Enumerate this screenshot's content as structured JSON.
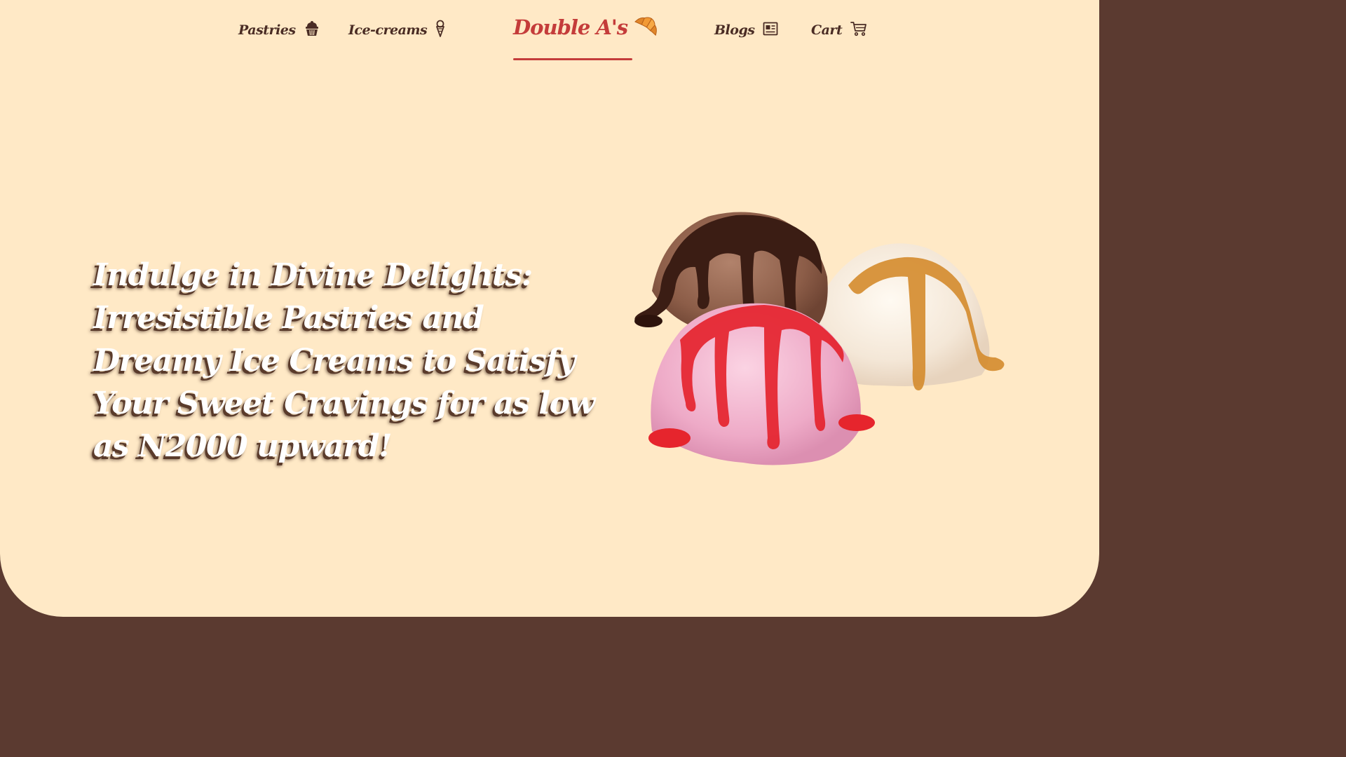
{
  "nav": {
    "pastries": {
      "label": "Pastries",
      "icon": "cupcake-icon"
    },
    "icecreams": {
      "label": "Ice-creams",
      "icon": "ice-cream-cone-icon"
    },
    "blogs": {
      "label": "Blogs",
      "icon": "newspaper-icon"
    },
    "cart": {
      "label": "Cart",
      "icon": "cart-icon"
    }
  },
  "logo": {
    "text": "Double A's",
    "icon": "croissant-icon",
    "color": "#c43c3a"
  },
  "hero": {
    "headline": "Indulge in Divine Delights: Irresistible Pastries and Dreamy Ice Creams to Satisfy Your Sweet Cravings for as low as N2000 upward!",
    "image": "three-ice-cream-scoops-illustration"
  },
  "colors": {
    "background": "#ffe9c6",
    "footer": "#5b3a30",
    "nav_text": "#4a2c24",
    "accent": "#c43c3a"
  }
}
